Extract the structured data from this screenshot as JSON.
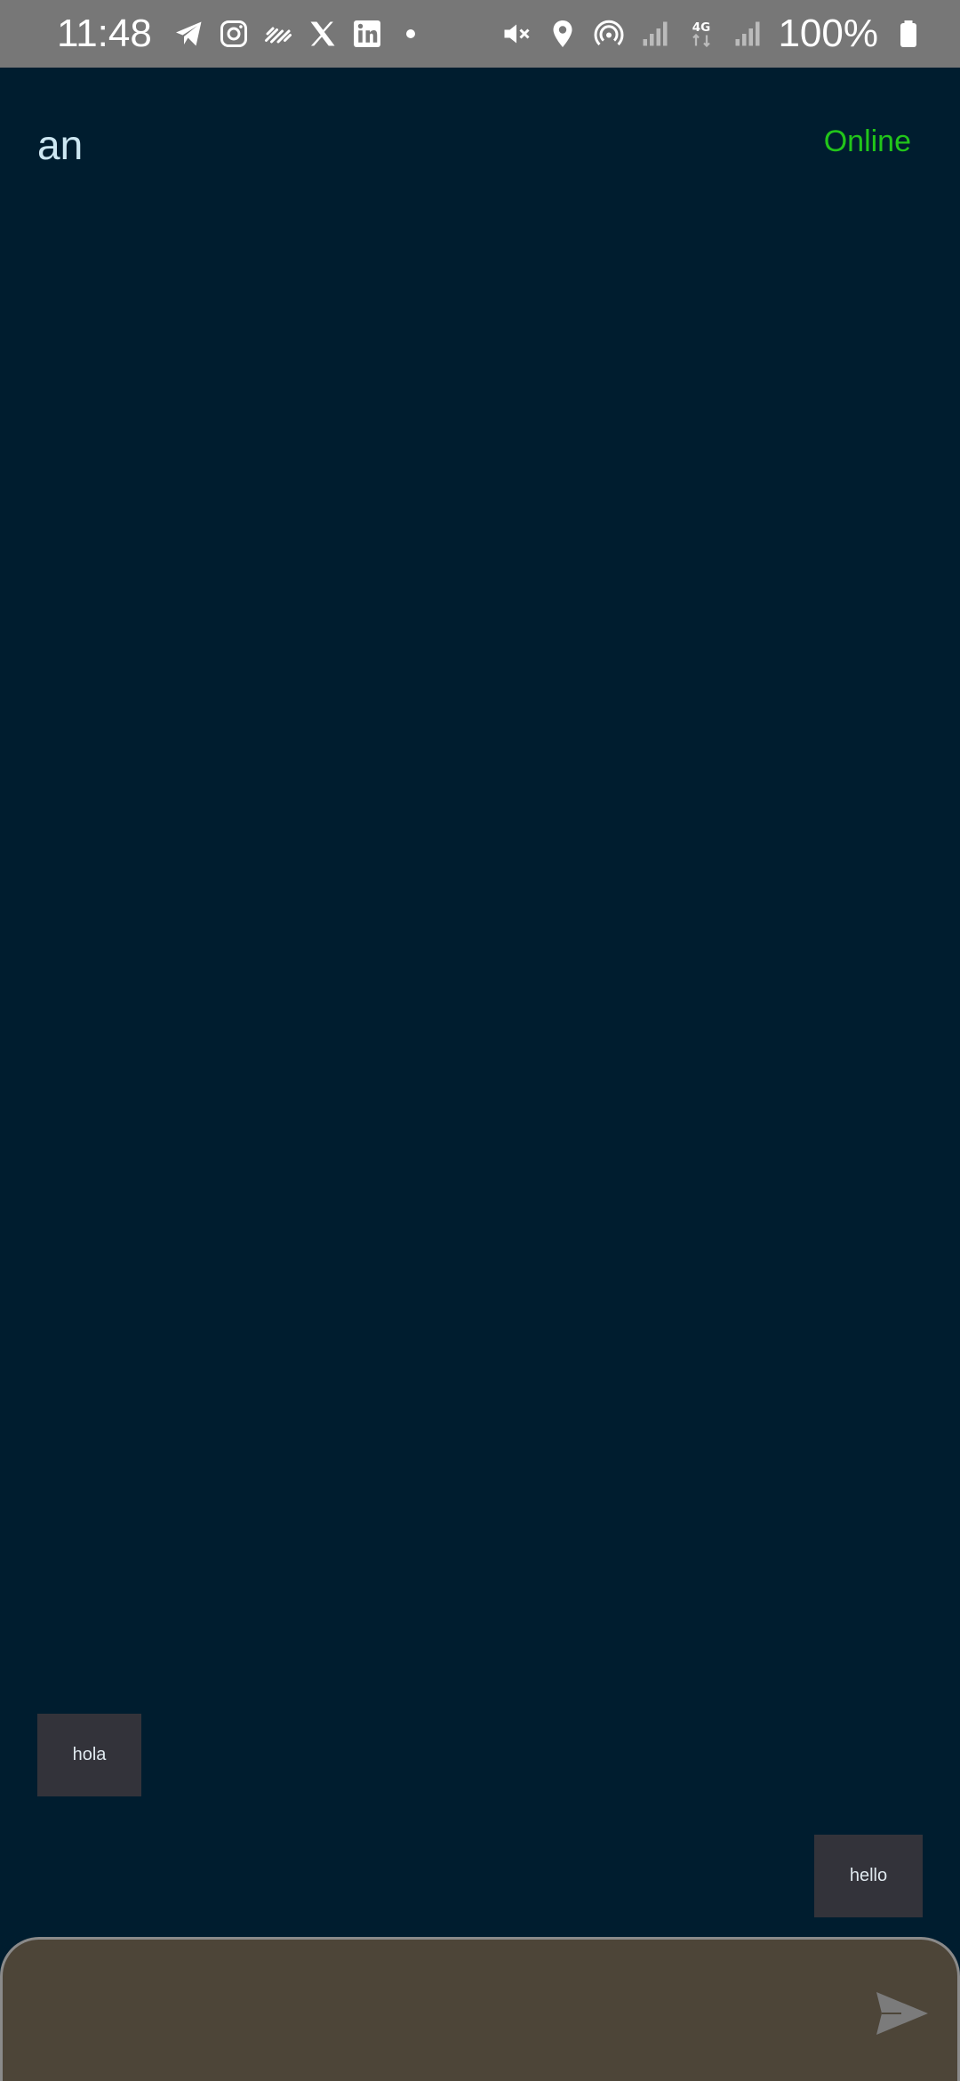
{
  "status_bar": {
    "time": "11:48",
    "battery_percent": "100%",
    "network_label": "4G",
    "left_icons": [
      "telegram-icon",
      "instagram-icon",
      "feed-icon",
      "x-icon",
      "linkedin-icon",
      "more-dot-icon"
    ],
    "right_icons": [
      "mute-icon",
      "location-icon",
      "hotspot-icon",
      "signal-icon",
      "network-4g-icon",
      "signal-icon",
      "battery-icon"
    ]
  },
  "header": {
    "contact_name": "an",
    "presence": "Online",
    "presence_color": "#22c51a"
  },
  "messages": [
    {
      "direction": "incoming",
      "text": "hola"
    },
    {
      "direction": "outgoing",
      "text": "hello"
    }
  ],
  "composer": {
    "placeholder": "",
    "value": "",
    "send_icon": "send-icon"
  },
  "colors": {
    "background": "#001d2f",
    "status_bar": "#777777",
    "bubble": "#33333a",
    "composer": "#4d4538"
  }
}
